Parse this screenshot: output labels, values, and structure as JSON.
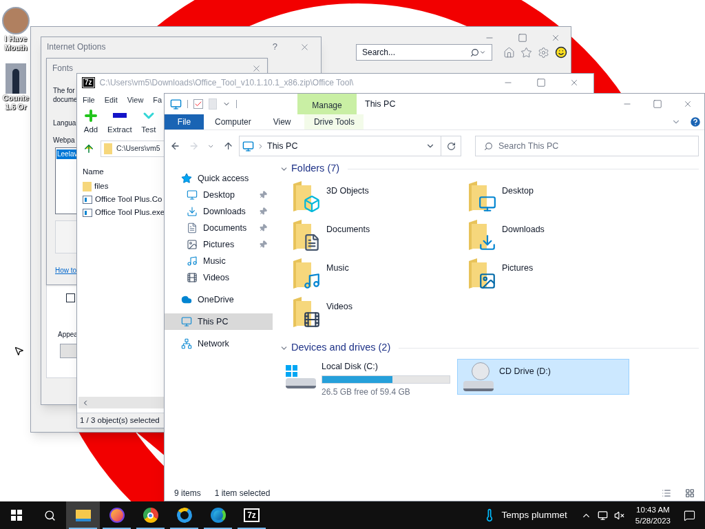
{
  "desktop": {
    "icons": [
      {
        "kind": "avatar",
        "lines": [
          "I Have",
          "Mouth"
        ]
      },
      {
        "kind": "game",
        "lines": [
          "Counte",
          "1.6 Or"
        ]
      }
    ]
  },
  "browser": {
    "search": {
      "placeholder": "Search..."
    }
  },
  "internet_options": {
    "title": "Internet Options",
    "help": "?",
    "checkbox": {
      "checked": false
    },
    "label": "Appea"
  },
  "fonts_dialog": {
    "title": "Fonts",
    "lines": [
      "The for",
      "docume"
    ],
    "language_label": "Langua",
    "webpage_label": "Webpa",
    "fonts_list": [
      {
        "name": "Leelav",
        "selected": true
      }
    ],
    "link": "How to"
  },
  "archiver": {
    "logo": "7z",
    "title": "C:\\Users\\vm5\\Downloads\\Office_Tool_v10.1.10.1_x86.zip\\Office Tool\\",
    "menu": [
      "File",
      "Edit",
      "View",
      "Fa"
    ],
    "toolbar": [
      {
        "kind": "add",
        "label": "Add"
      },
      {
        "kind": "extract",
        "label": "Extract"
      },
      {
        "kind": "test",
        "label": "Test"
      }
    ],
    "address": "C:\\Users\\vm5",
    "column": "Name",
    "files": [
      {
        "kind": "folder",
        "name": "files"
      },
      {
        "kind": "app",
        "name": "Office Tool Plus.Co"
      },
      {
        "kind": "app",
        "name": "Office Tool Plus.exe"
      }
    ],
    "status": "1 / 3 object(s) selected"
  },
  "explorer": {
    "title": "This PC",
    "context_tab": "Manage",
    "ribbon_tabs": [
      {
        "kind": "file",
        "label": "File"
      },
      {
        "kind": "tab",
        "label": "Computer"
      },
      {
        "kind": "tab",
        "label": "View"
      },
      {
        "kind": "context",
        "label": "Drive Tools"
      }
    ],
    "address": "This PC",
    "search": {
      "placeholder": "Search This PC"
    },
    "nav": [
      {
        "kind": "quick",
        "label": "Quick access",
        "selected": false,
        "children": [
          {
            "kind": "desktop",
            "label": "Desktop",
            "pinned": true,
            "selected": false
          },
          {
            "kind": "downloads",
            "label": "Downloads",
            "pinned": true,
            "selected": false
          },
          {
            "kind": "documents",
            "label": "Documents",
            "pinned": true,
            "selected": false
          },
          {
            "kind": "pictures",
            "label": "Pictures",
            "pinned": true,
            "selected": false
          },
          {
            "kind": "music",
            "label": "Music",
            "pinned": false,
            "selected": false
          },
          {
            "kind": "videos",
            "label": "Videos",
            "pinned": false,
            "selected": false
          }
        ]
      },
      {
        "kind": "cloud",
        "label": "OneDrive",
        "selected": false
      },
      {
        "kind": "pc",
        "label": "This PC",
        "selected": true
      },
      {
        "kind": "network",
        "label": "Network",
        "selected": false
      }
    ],
    "groups": [
      {
        "kind": "folders",
        "title": "Folders (7)",
        "expanded": true,
        "items": [
          {
            "kind": "objects",
            "name": "3D Objects"
          },
          {
            "kind": "desktop",
            "name": "Desktop"
          },
          {
            "kind": "documents",
            "name": "Documents"
          },
          {
            "kind": "downloads",
            "name": "Downloads"
          },
          {
            "kind": "music",
            "name": "Music"
          },
          {
            "kind": "pictures",
            "name": "Pictures"
          },
          {
            "kind": "videos",
            "name": "Videos"
          }
        ]
      },
      {
        "kind": "drives",
        "title": "Devices and drives (2)",
        "expanded": true,
        "items": [
          {
            "kind": "disk",
            "name": "Local Disk (C:)",
            "level": 0.55,
            "reading": "26.5 GB free of 59.4 GB",
            "selected": false
          },
          {
            "kind": "cd",
            "name": "CD Drive (D:)",
            "selected": true
          }
        ]
      }
    ],
    "status": [
      "9 items",
      "1 item selected"
    ]
  },
  "taskbar": {
    "apps": [
      {
        "kind": "explorer",
        "running": true,
        "selected": true
      },
      {
        "kind": "firefox",
        "running": true,
        "selected": false
      },
      {
        "kind": "chrome",
        "running": true,
        "selected": false
      },
      {
        "kind": "ie",
        "running": true,
        "selected": false
      },
      {
        "kind": "edge",
        "running": true,
        "selected": false
      },
      {
        "kind": "sevenzip",
        "running": true,
        "selected": false,
        "logo": "7z"
      }
    ],
    "weather": "Temps plummet",
    "time": "10:43 AM",
    "date": "5/28/2023"
  }
}
